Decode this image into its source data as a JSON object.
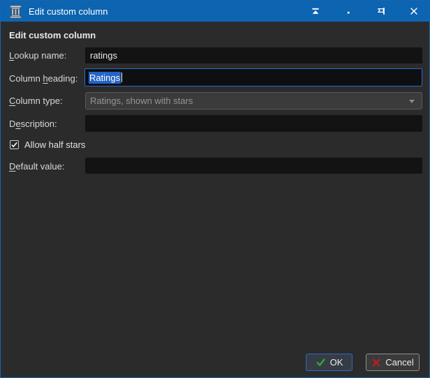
{
  "window": {
    "title": "Edit custom column",
    "controls": {
      "shade": "shade-window",
      "minimize": "minimize-window",
      "pin": "keep-on-top",
      "close": "close-window"
    }
  },
  "colors": {
    "titlebar_blue": "#0d64b0",
    "dialog_bg": "#2b2b2b",
    "input_bg": "#131313",
    "focus_border_blue": "#2a6bc7",
    "selection_blue": "#2464c6",
    "disabled_combo_bg": "#3b3b3b",
    "ok_check_green": "#2fa832",
    "cancel_x_red": "#b51f23"
  },
  "form": {
    "heading": "Edit custom column",
    "fields": {
      "lookup_name": {
        "label": "&Lookup name:",
        "value": "ratings",
        "disabled": false
      },
      "column_heading": {
        "label": "Column &heading:",
        "value": "Ratings",
        "focused": true,
        "text_selected": true
      },
      "column_type": {
        "label": "&Column type:",
        "value": "Ratings, shown with stars",
        "disabled": true
      },
      "description": {
        "label": "D&escription:",
        "value": ""
      },
      "default_value": {
        "label": "&Default value:",
        "value": ""
      }
    },
    "allow_half_stars": {
      "label": "Allow half stars",
      "checked": true
    }
  },
  "buttons": {
    "ok": "OK",
    "cancel": "Cancel"
  }
}
